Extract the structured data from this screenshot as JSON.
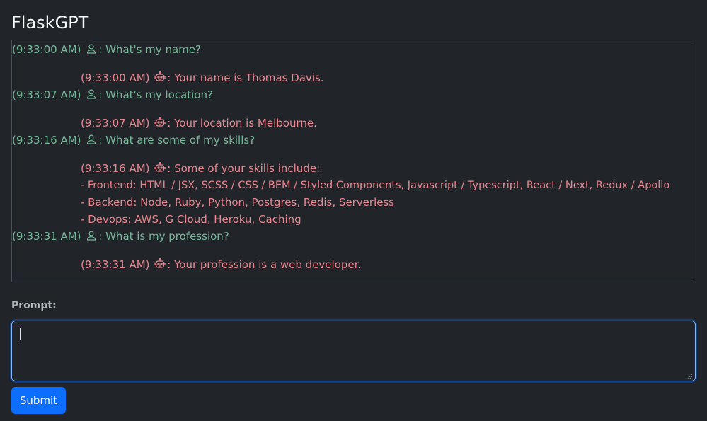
{
  "app": {
    "title": "FlaskGPT"
  },
  "colors": {
    "background": "#212529",
    "user_text": "#75b798",
    "bot_text": "#ea868f",
    "primary_button": "#0d6efd"
  },
  "chat": {
    "messages": [
      {
        "role": "user",
        "icon": "user-icon",
        "time": "(9:33:00 AM)",
        "lines": [
          ": What's my name?"
        ]
      },
      {
        "role": "bot",
        "icon": "robot-icon",
        "time": "(9:33:00 AM)",
        "lines": [
          ": Your name is Thomas Davis."
        ]
      },
      {
        "role": "user",
        "icon": "user-icon",
        "time": "(9:33:07 AM)",
        "lines": [
          ": What's my location?"
        ]
      },
      {
        "role": "bot",
        "icon": "robot-icon",
        "time": "(9:33:07 AM)",
        "lines": [
          ": Your location is Melbourne."
        ]
      },
      {
        "role": "user",
        "icon": "user-icon",
        "time": "(9:33:16 AM)",
        "lines": [
          ": What are some of my skills?"
        ]
      },
      {
        "role": "bot",
        "icon": "robot-icon",
        "time": "(9:33:16 AM)",
        "lines": [
          ": Some of your skills include:",
          "- Frontend: HTML / JSX, SCSS / CSS / BEM / Styled Components, Javascript / Typescript, React / Next, Redux / Apollo",
          "- Backend: Node, Ruby, Python, Postgres, Redis, Serverless",
          "- Devops: AWS, G Cloud, Heroku, Caching"
        ]
      },
      {
        "role": "user",
        "icon": "user-icon",
        "time": "(9:33:31 AM)",
        "lines": [
          ": What is my profession?"
        ]
      },
      {
        "role": "bot",
        "icon": "robot-icon",
        "time": "(9:33:31 AM)",
        "lines": [
          ": Your profession is a web developer."
        ]
      }
    ]
  },
  "form": {
    "prompt_label": "Prompt:",
    "prompt_value": "",
    "submit_label": "Submit"
  }
}
